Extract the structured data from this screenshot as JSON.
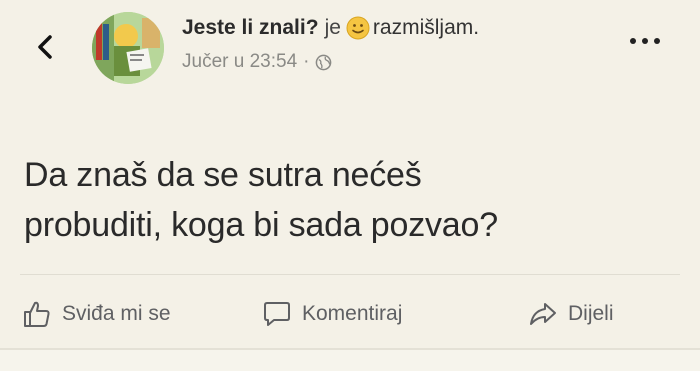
{
  "header": {
    "back_icon": "chevron-left-icon",
    "page_name": "Jeste li znali?",
    "feeling_prefix": "je",
    "feeling_icon": "smiley-emoji-icon",
    "feeling": "razmišljam.",
    "timestamp": "Jučer u 23:54",
    "separator": "·",
    "privacy_icon": "globe-icon",
    "more_icon": "more-options-icon"
  },
  "post": {
    "line1": "Da znaš da se sutra nećeš",
    "line2": "probuditi, koga bi sada pozvao?"
  },
  "actions": {
    "like_label": "Sviđa mi se",
    "comment_label": "Komentiraj",
    "share_label": "Dijeli"
  },
  "colors": {
    "background": "#f4f1e7",
    "text": "#2a2a2a",
    "muted": "#5f6063"
  }
}
